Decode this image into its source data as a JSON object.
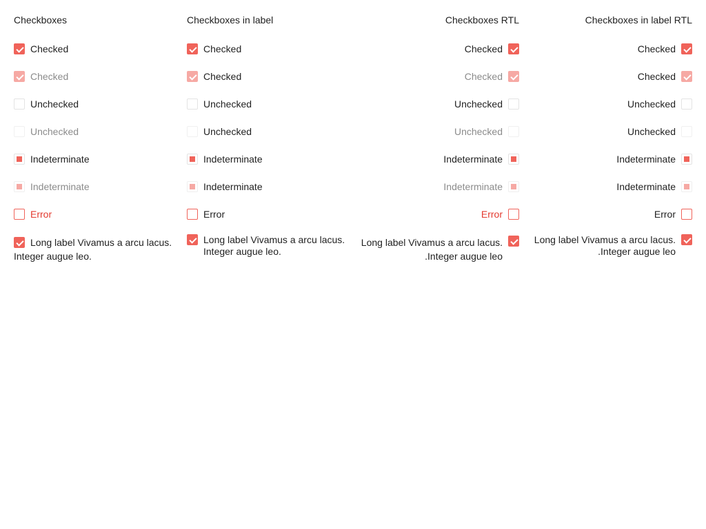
{
  "columns": [
    {
      "title": "Checkboxes",
      "rows": [
        {
          "label": "Checked"
        },
        {
          "label": "Checked"
        },
        {
          "label": "Unchecked"
        },
        {
          "label": "Unchecked"
        },
        {
          "label": "Indeterminate"
        },
        {
          "label": "Indeterminate"
        },
        {
          "label": "Error"
        },
        {
          "label": "Long label Vivamus a arcu lacus. Integer augue leo."
        }
      ]
    },
    {
      "title": "Checkboxes in label",
      "rows": [
        {
          "label": "Checked"
        },
        {
          "label": "Checked"
        },
        {
          "label": "Unchecked"
        },
        {
          "label": "Unchecked"
        },
        {
          "label": "Indeterminate"
        },
        {
          "label": "Indeterminate"
        },
        {
          "label": "Error"
        },
        {
          "label": "Long label Vivamus a arcu lacus. Integer augue leo."
        }
      ]
    },
    {
      "title": "Checkboxes RTL",
      "rows": [
        {
          "label": "Checked"
        },
        {
          "label": "Checked"
        },
        {
          "label": "Unchecked"
        },
        {
          "label": "Unchecked"
        },
        {
          "label": "Indeterminate"
        },
        {
          "label": "Indeterminate"
        },
        {
          "label": "Error"
        },
        {
          "label": "Long label Vivamus a arcu lacus. Integer augue leo."
        }
      ]
    },
    {
      "title": "Checkboxes in label RTL",
      "rows": [
        {
          "label": "Checked"
        },
        {
          "label": "Checked"
        },
        {
          "label": "Unchecked"
        },
        {
          "label": "Unchecked"
        },
        {
          "label": "Indeterminate"
        },
        {
          "label": "Indeterminate"
        },
        {
          "label": "Error"
        },
        {
          "label": "Long label Vivamus a arcu lacus. Integer augue leo."
        }
      ]
    }
  ],
  "colors": {
    "accent": "#f0635a",
    "error_text": "#e33a2f",
    "disabled_text": "#8b8b8b",
    "border": "#e3e3e3"
  }
}
